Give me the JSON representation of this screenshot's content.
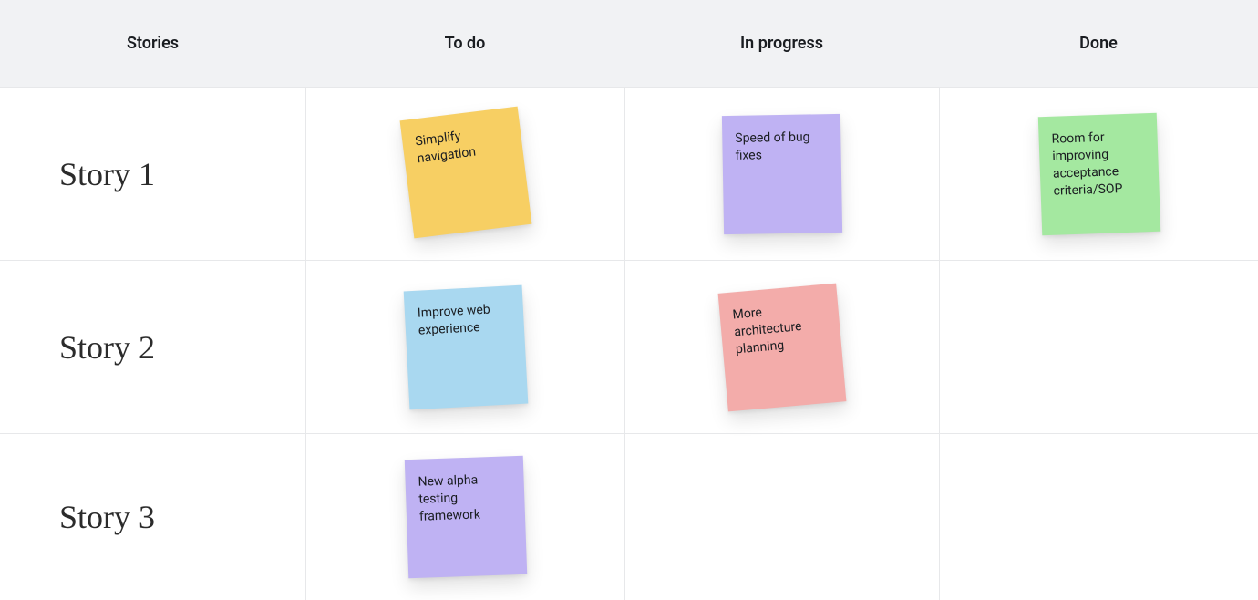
{
  "columns": {
    "stories": "Stories",
    "todo": "To do",
    "inprogress": "In progress",
    "done": "Done"
  },
  "rows": [
    {
      "label": "Story 1",
      "cards": {
        "todo": {
          "text": "Simplify navigation",
          "color": "yellow"
        },
        "inprogress": {
          "text": "Speed of bug fixes",
          "color": "purple"
        },
        "done": {
          "text": "Room for improving acceptance criteria/SOP",
          "color": "green"
        }
      }
    },
    {
      "label": "Story 2",
      "cards": {
        "todo": {
          "text": "Improve web experience",
          "color": "blue"
        },
        "inprogress": {
          "text": "More architecture planning",
          "color": "pink"
        }
      }
    },
    {
      "label": "Story 3",
      "cards": {
        "todo": {
          "text": "New alpha testing framework",
          "color": "purple"
        }
      }
    }
  ]
}
